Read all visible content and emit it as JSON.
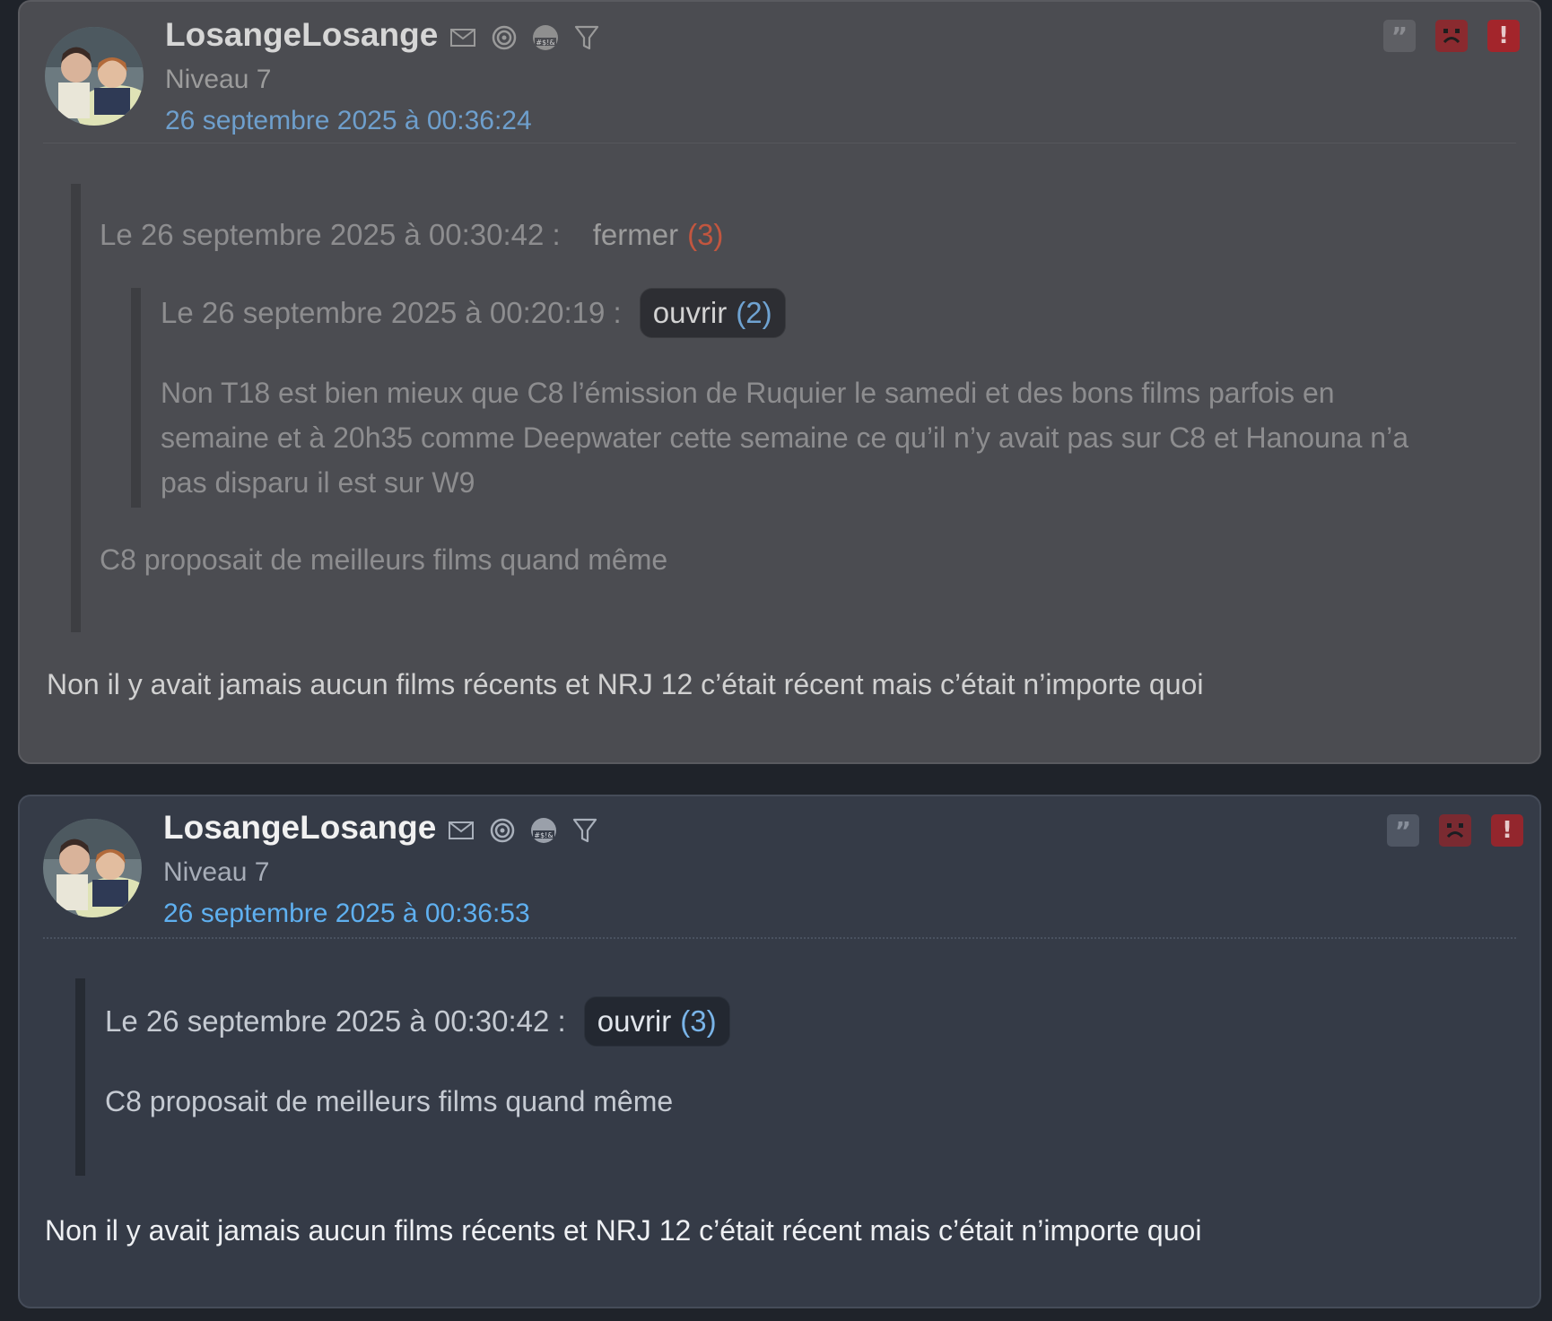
{
  "posts": [
    {
      "author": "LosangeLosange",
      "level": "Niveau 7",
      "date": "26 septembre 2025 à 00:36:24",
      "quote": {
        "header": "Le 26 septembre 2025 à 00:30:42 :",
        "toggle_label": "fermer",
        "toggle_count": "(3)",
        "nested": {
          "header": "Le 26 septembre 2025 à 00:20:19 :",
          "toggle_label": "ouvrir",
          "toggle_count": "(2)",
          "lines": [
            "Non T18 est bien mieux que C8 l’émission de Ruquier le samedi et des bons films parfois en",
            "semaine et à 20h35 comme Deepwater cette semaine ce qu’il n’y avait pas sur C8 et Hanouna n’a",
            "pas disparu il est sur W9"
          ]
        },
        "text": "C8 proposait de meilleurs films quand même"
      },
      "message": "Non il y avait jamais aucun films récents et NRJ 12 c’était récent mais c’était n’importe quoi"
    },
    {
      "author": "LosangeLosange",
      "level": "Niveau 7",
      "date": "26 septembre 2025 à 00:36:53",
      "quote": {
        "header": "Le 26 septembre 2025 à 00:30:42 :",
        "toggle_label": "ouvrir",
        "toggle_count": "(3)",
        "text": "C8 proposait de meilleurs films quand même"
      },
      "message": "Non il y avait jamais aucun films récents et NRJ 12 c’était récent mais c’était n’importe quoi"
    }
  ],
  "icons": {
    "user_icons": [
      "mail-icon",
      "spiral-icon",
      "swear-emoji-icon",
      "filter-icon"
    ],
    "actions": [
      "quote-icon",
      "sad-face-icon",
      "report-icon"
    ]
  }
}
